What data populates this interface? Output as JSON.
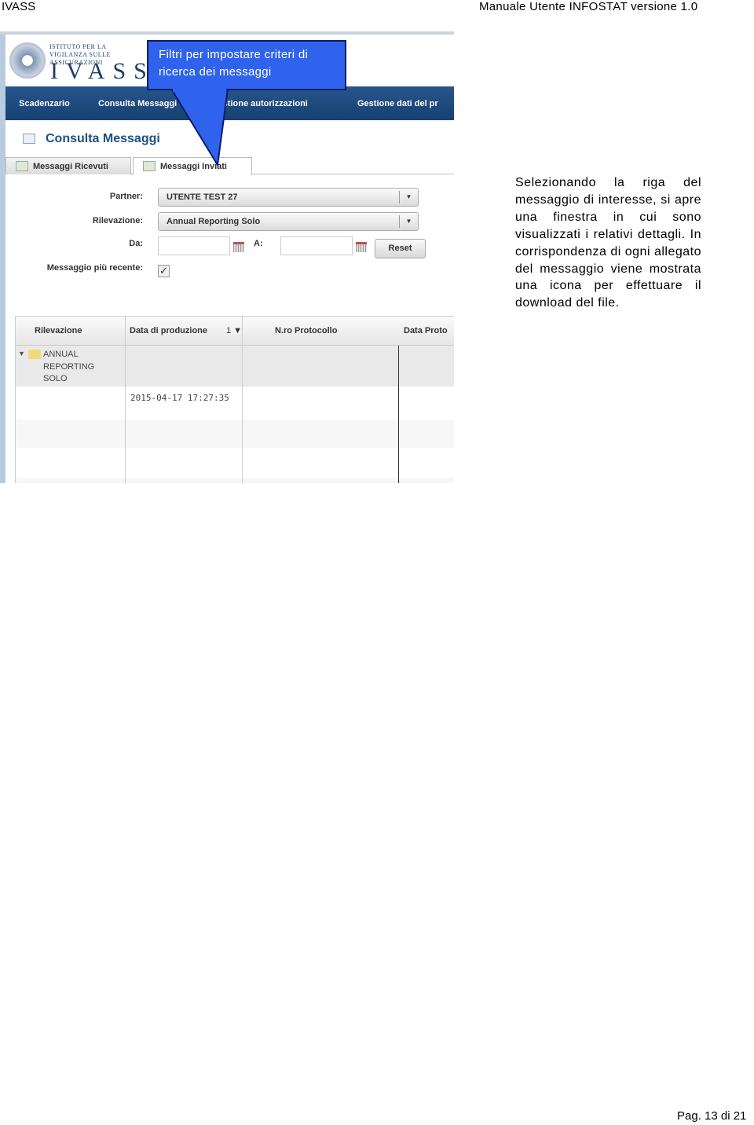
{
  "header": {
    "left": "IVASS",
    "right": "Manuale Utente INFOSTAT versione 1.0"
  },
  "app": {
    "logo_text": {
      "institute": "ISTITUTO PER LA VIGILANZA SULLE ASSICURAZIONI",
      "name": "IVASS"
    },
    "nav": [
      "Scadenzario",
      "Consulta Messaggi",
      "Gestione autorizzazioni",
      "Gestione dati del pr"
    ],
    "page_title": "Consulta Messaggi",
    "tabs": [
      {
        "label": "Messaggi Ricevuti",
        "active": false
      },
      {
        "label": "Messaggi Inviati",
        "active": true
      }
    ],
    "form": {
      "partner_label": "Partner:",
      "partner_value": "UTENTE TEST 27",
      "rilevazione_label": "Rilevazione:",
      "rilevazione_value": "Annual Reporting Solo",
      "da_label": "Da:",
      "da_value": "",
      "a_label": "A:",
      "a_value": "",
      "reset_label": "Reset",
      "recent_label": "Messaggio più recente:",
      "recent_checked": true,
      "check_glyph": "✓"
    },
    "grid": {
      "columns": [
        "Rilevazione",
        "Data di produzione",
        "N.ro Protocollo",
        "Data Proto"
      ],
      "sort_indicator": "1 ▼",
      "group": "ANNUAL REPORTING SOLO",
      "rows": [
        {
          "data_produzione": "2015-04-17 17:27:35"
        }
      ]
    }
  },
  "callout": "Filtri per impostare criteri di ricerca dei messaggi",
  "body_text": "Selezionando la riga del messaggio di interesse, si apre una finestra in cui sono visualizzati i relativi dettagli. In corrispondenza di ogni allegato del messaggio viene mostrata una icona per effettuare il download del file.",
  "footer": "Pag. 13 di 21",
  "colors": {
    "nav": "#1f4a7e",
    "callout": "#2f63ee",
    "title": "#1d4f87"
  }
}
